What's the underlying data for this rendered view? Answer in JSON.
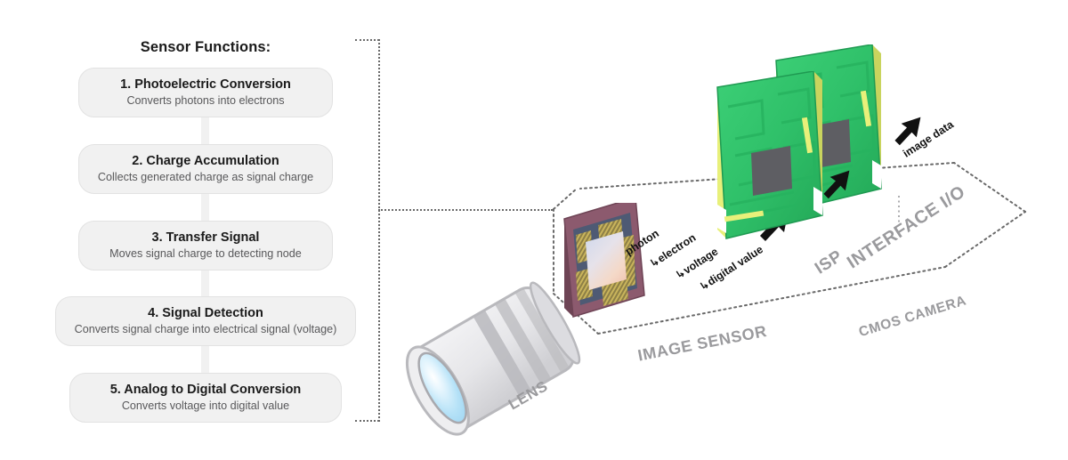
{
  "flow": {
    "title": "Sensor Functions:",
    "steps": [
      {
        "title": "1. Photoelectric Conversion",
        "desc": "Converts photons into electrons"
      },
      {
        "title": "2. Charge Accumulation",
        "desc": "Collects generated charge as signal charge"
      },
      {
        "title": "3. Transfer Signal",
        "desc": "Moves signal charge to detecting node"
      },
      {
        "title": "4. Signal Detection",
        "desc": "Converts signal charge into electrical signal (voltage)"
      },
      {
        "title": "5. Analog to Digital Conversion",
        "desc": "Converts voltage into digital value"
      }
    ]
  },
  "diagram": {
    "component_labels": {
      "lens": "LENS",
      "image_sensor": "IMAGE SENSOR",
      "isp": "ISP",
      "interface_io": "INTERFACE I/O",
      "cmos_camera": "CMOS CAMERA"
    },
    "signal_labels": {
      "photon": "photon",
      "electron": "electron",
      "voltage": "voltage",
      "digital_value": "digital value",
      "image_data": "image data"
    },
    "branch_glyph": "↳"
  },
  "colors": {
    "box_fill": "#f1f1f1",
    "box_border": "#e2e2e2",
    "title_text": "#1a1a1a",
    "desc_text": "#58585a",
    "iso_label": "#9a9a9d",
    "dotted_line": "#6a6a6a",
    "pcb_green": "#2fc069",
    "pcb_green_dark": "#1f9a52",
    "pcb_edge_yellow": "#e8f07a",
    "chip_gray": "#5e5e63",
    "sensor_frame": "#8c5a6e",
    "sensor_substrate": "#4e5a74",
    "sensor_gold": "#c9b45c",
    "lens_body": "#e9e9eb",
    "lens_ring": "#b9b9bd",
    "lens_glass": "#b8e4f7",
    "arrow_black": "#111111"
  }
}
